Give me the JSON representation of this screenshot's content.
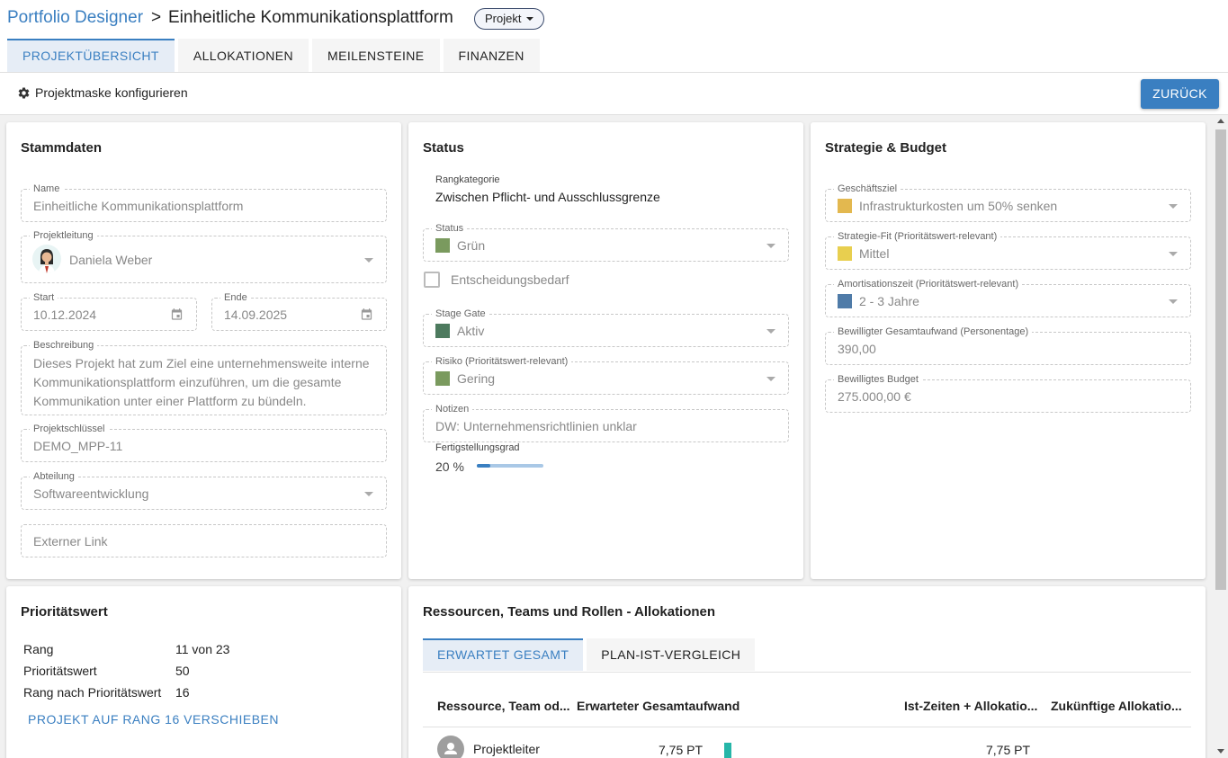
{
  "header": {
    "app": "Portfolio Designer",
    "separator": ">",
    "title": "Einheitliche Kommunikationsplattform",
    "type_badge": "Projekt"
  },
  "tabs": [
    {
      "label": "PROJEKTÜBERSICHT",
      "active": true
    },
    {
      "label": "ALLOKATIONEN",
      "active": false
    },
    {
      "label": "MEILENSTEINE",
      "active": false
    },
    {
      "label": "FINANZEN",
      "active": false
    }
  ],
  "toolbar": {
    "config_label": "Projektmaske konfigurieren",
    "back_label": "ZURÜCK"
  },
  "stammdaten": {
    "title": "Stammdaten",
    "name": {
      "label": "Name",
      "value": "Einheitliche Kommunikationsplattform"
    },
    "lead": {
      "label": "Projektleitung",
      "value": "Daniela Weber"
    },
    "start": {
      "label": "Start",
      "value": "10.12.2024"
    },
    "end": {
      "label": "Ende",
      "value": "14.09.2025"
    },
    "description": {
      "label": "Beschreibung",
      "value": "Dieses Projekt hat zum Ziel eine unternehmensweite interne Kommunikationsplattform einzuführen, um die gesamte Kommunikation unter einer Plattform zu bündeln."
    },
    "key": {
      "label": "Projektschlüssel",
      "value": "DEMO_MPP-11"
    },
    "department": {
      "label": "Abteilung",
      "value": "Softwareentwicklung"
    },
    "link": {
      "placeholder": "Externer Link"
    }
  },
  "status": {
    "title": "Status",
    "rank_category": {
      "label": "Rangkategorie",
      "value": "Zwischen Pflicht- und Ausschlussgrenze"
    },
    "status": {
      "label": "Status",
      "value": "Grün",
      "color": "#7a9a5e"
    },
    "decision": {
      "label": "Entscheidungsbedarf",
      "checked": false
    },
    "stage_gate": {
      "label": "Stage Gate",
      "value": "Aktiv",
      "color": "#4d7a5e"
    },
    "risk": {
      "label": "Risiko (Prioritätswert-relevant)",
      "value": "Gering",
      "color": "#7a9a5e"
    },
    "notes": {
      "label": "Notizen",
      "value": "DW: Unternehmensrichtlinien unklar"
    },
    "completion": {
      "label": "Fertigstellungsgrad",
      "value_text": "20 %",
      "fraction": 0.2
    }
  },
  "strategy": {
    "title": "Strategie & Budget",
    "goal": {
      "label": "Geschäftsziel",
      "value": "Infrastrukturkosten um 50% senken",
      "color": "#e3b84f"
    },
    "fit": {
      "label": "Strategie-Fit (Prioritätswert-relevant)",
      "value": "Mittel",
      "color": "#e8cf4f"
    },
    "amortization": {
      "label": "Amortisationszeit (Prioritätswert-relevant)",
      "value": "2 - 3 Jahre",
      "color": "#4f7ba8"
    },
    "effort": {
      "label": "Bewilligter Gesamtaufwand (Personentage)",
      "value": "390,00"
    },
    "budget": {
      "label": "Bewilligtes Budget",
      "value": "275.000,00 €"
    }
  },
  "priority": {
    "title": "Prioritätswert",
    "rows": [
      {
        "label": "Rang",
        "value": "11 von 23"
      },
      {
        "label": "Prioritätswert",
        "value": "50"
      },
      {
        "label": "Rang nach Prioritätswert",
        "value": "16"
      }
    ],
    "move_button": "PROJEKT AUF RANG 16 VERSCHIEBEN"
  },
  "allocations": {
    "title": "Ressourcen, Teams und Rollen - Allokationen",
    "tabs": [
      {
        "label": "ERWARTET GESAMT",
        "active": true
      },
      {
        "label": "PLAN-IST-VERGLEICH",
        "active": false
      }
    ],
    "columns": [
      "Ressource, Team od...",
      "Erwarteter Gesamtaufwand",
      "Ist-Zeiten + Allokatio...",
      "Zukünftige Allokatio..."
    ],
    "rows": [
      {
        "name": "Projektleiter",
        "expected": "7,75 PT",
        "actual": "7,75 PT",
        "future": ""
      }
    ],
    "bar_color": "#26b6a8"
  }
}
